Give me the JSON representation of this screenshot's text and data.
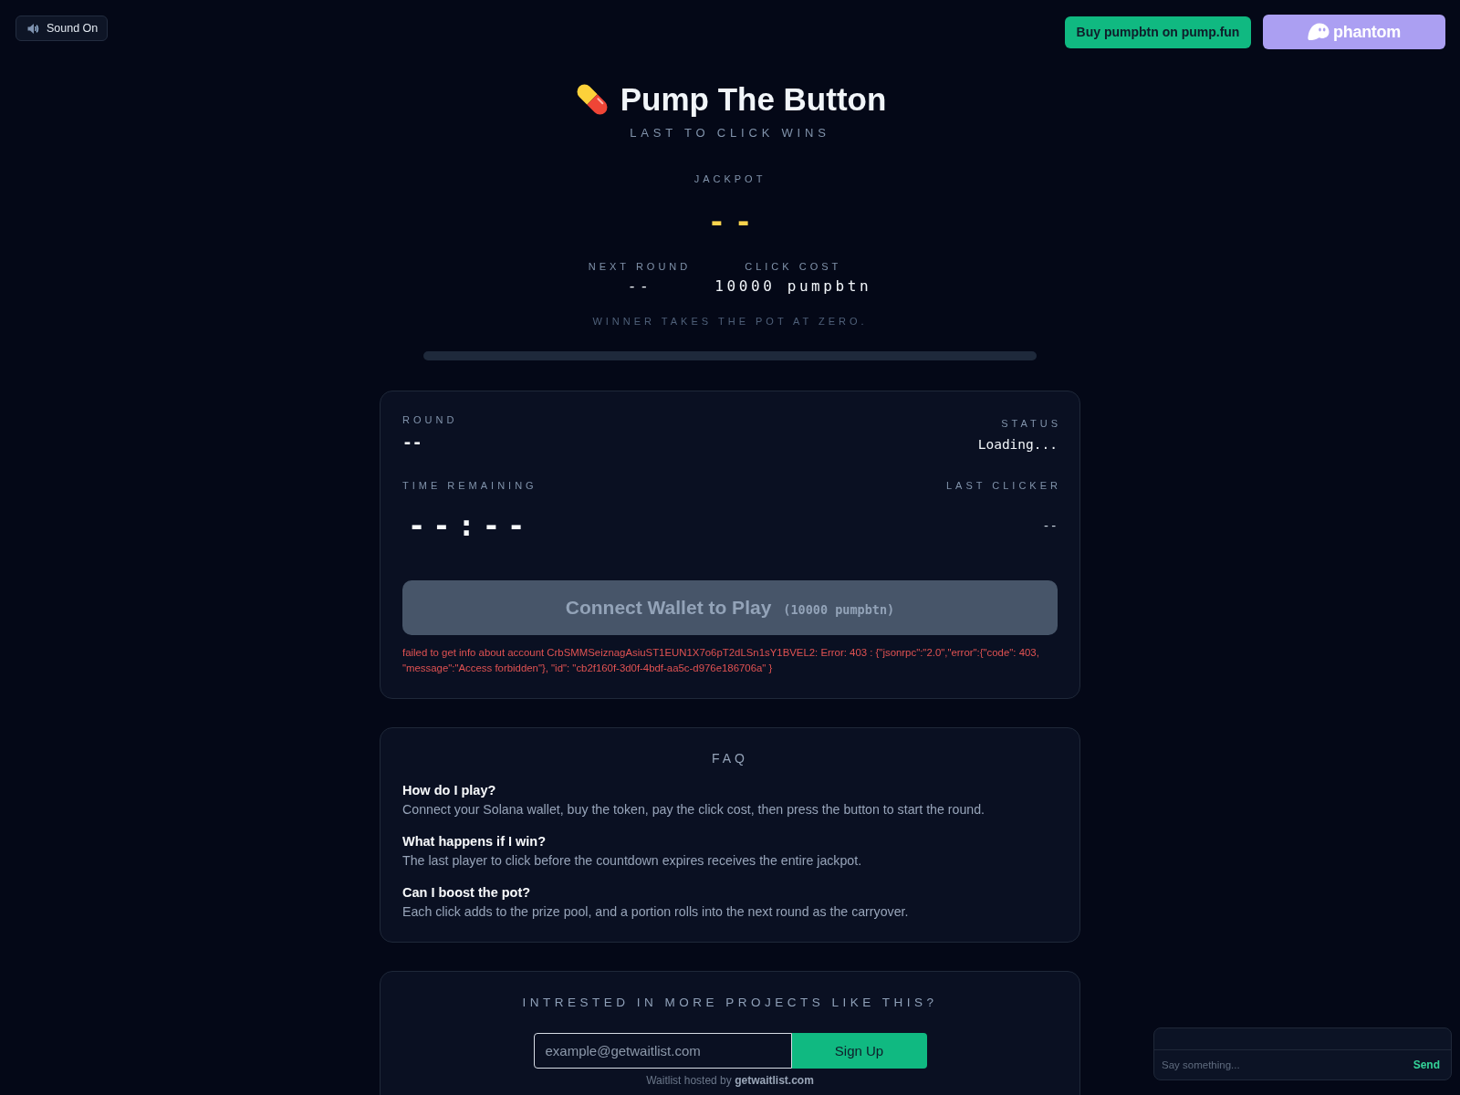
{
  "sound_toggle": {
    "label": "Sound On",
    "on": true
  },
  "top_links": [
    {
      "kind": "buy",
      "label": "Buy pumpbtn on pump.fun"
    },
    {
      "kind": "wallet",
      "label": "phantom"
    }
  ],
  "header": {
    "title": "Pump The Button",
    "tagline": "LAST TO CLICK WINS"
  },
  "jackpot": {
    "label": "JACKPOT",
    "value": "--"
  },
  "stats": [
    {
      "label": "NEXT ROUND",
      "value": "--"
    },
    {
      "label": "CLICK COST",
      "value": "10000 pumpbtn"
    }
  ],
  "note": "WINNER TAKES THE POT AT ZERO.",
  "progress": {
    "level": 0
  },
  "round_card": {
    "fields": [
      {
        "kind": "number",
        "label": "ROUND",
        "value": "--"
      },
      {
        "kind": "status",
        "label": "STATUS",
        "value": "Loading..."
      },
      {
        "kind": "timer",
        "label": "TIME REMAINING",
        "value": "--:--"
      },
      {
        "kind": "address",
        "label": "LAST CLICKER",
        "value": "--"
      }
    ],
    "play_button": {
      "label": "Connect Wallet to Play",
      "cost": "(10000 pumpbtn)",
      "disabled": true
    },
    "error": "failed to get info about account CrbSMMSeiznagAsiuST1EUN1X7o6pT2dLSn1sY1BVEL2: Error: 403 : {\"jsonrpc\":\"2.0\",\"error\":{\"code\": 403, \"message\":\"Access forbidden\"}, \"id\": \"cb2f160f-3d0f-4bdf-aa5c-d976e186706a\" }"
  },
  "faq": {
    "title": "FAQ",
    "items": [
      {
        "question": "How do I play?",
        "answer": "Connect your Solana wallet, buy the token, pay the click cost, then press the button to start the round."
      },
      {
        "question": "What happens if I win?",
        "answer": "The last player to click before the countdown expires receives the entire jackpot."
      },
      {
        "question": "Can I boost the pot?",
        "answer": "Each click adds to the prize pool, and a portion rolls into the next round as the carryover."
      }
    ]
  },
  "waitlist": {
    "heading": "INTRESTED IN MORE PROJECTS LIKE THIS?",
    "email_placeholder": "example@getwaitlist.com",
    "button": "Sign Up",
    "credit": "Waitlist hosted by",
    "credit_link": "getwaitlist.com"
  },
  "chat": {
    "placeholder": "Say something...",
    "send": "Send"
  }
}
